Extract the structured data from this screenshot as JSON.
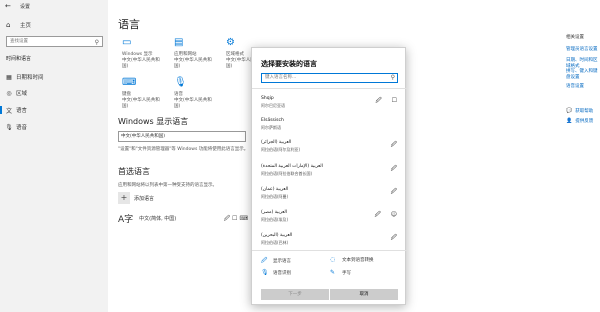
{
  "window": {
    "title": "设置",
    "back_glyph": "←"
  },
  "sidebar": {
    "home": "主页",
    "search_placeholder": "查找设置",
    "section": "时间和语言",
    "items": [
      {
        "label": "日期和时间",
        "icon": "calendar-icon"
      },
      {
        "label": "区域",
        "icon": "globe-icon"
      },
      {
        "label": "语言",
        "icon": "language-icon",
        "selected": true
      },
      {
        "label": "语音",
        "icon": "microphone-icon"
      }
    ]
  },
  "main": {
    "title": "语言",
    "tiles": [
      {
        "line1": "Windows 显示",
        "line2": "中文(中华人民共和国)"
      },
      {
        "line1": "应用和网站",
        "line2": "中文(中华人民共和国)"
      },
      {
        "line1": "区域格式",
        "line2": "中文(中华人民共和国)"
      },
      {
        "line1": "键盘",
        "line2": "中文(中华人民共和国)"
      },
      {
        "line1": "语音",
        "line2": "中文(中华人民共和国)"
      }
    ],
    "display_lang_heading": "Windows 显示语言",
    "display_lang_value": "中文(中华人民共和国)",
    "display_lang_desc": "\"设置\"和\"文件资源管理器\"等 Windows 功能将使用此语言显示。",
    "preferred_heading": "首选语言",
    "preferred_desc": "应用和网站将以列表中第一种受支持的语言显示。",
    "add_lang": "添加语言",
    "lang_row": "中文(简体, 中国)"
  },
  "right": {
    "title": "相关设置",
    "links": [
      "管理员语言设置",
      "日期、时间和区域格式",
      "拼写、键入和键盘设置",
      "语音设置"
    ],
    "help": [
      {
        "label": "获取帮助",
        "icon": "help-icon"
      },
      {
        "label": "提供反馈",
        "icon": "feedback-icon"
      }
    ]
  },
  "dialog": {
    "title": "选择要安装的语言",
    "search_placeholder": "键入语言名称...",
    "languages": [
      {
        "name": "Shqip",
        "sub": "阿尔巴尼亚语",
        "icons": "🖉 ☐"
      },
      {
        "name": "Elsässisch",
        "sub": "阿尔萨斯语",
        "icons": ""
      },
      {
        "name": "العربية (الجزائر)",
        "sub": "阿拉伯语(阿尔及利亚)",
        "icons": "🖉"
      },
      {
        "name": "العربية (الإمارات العربية المتحدة)",
        "sub": "阿拉伯语(阿拉伯联合酋长国)",
        "icons": "🖉"
      },
      {
        "name": "العربية (عمان)",
        "sub": "阿拉伯语(阿曼)",
        "icons": "🖉"
      },
      {
        "name": "العربية (مصر)",
        "sub": "阿拉伯语(埃及)",
        "icons": "🖉 ☺"
      },
      {
        "name": "العربية (البحرين)",
        "sub": "阿拉伯语(巴林)",
        "icons": "🖉"
      }
    ],
    "legend": [
      {
        "label": "显示语言",
        "icon": "display-language-icon",
        "glyph": "🖉"
      },
      {
        "label": "文本到语音转换",
        "icon": "text-to-speech-icon",
        "glyph": "◌"
      },
      {
        "label": "语音识别",
        "icon": "speech-recognition-icon",
        "glyph": "🎙"
      },
      {
        "label": "手写",
        "icon": "handwriting-icon",
        "glyph": "✎"
      }
    ],
    "next": "下一步",
    "cancel": "取消"
  }
}
